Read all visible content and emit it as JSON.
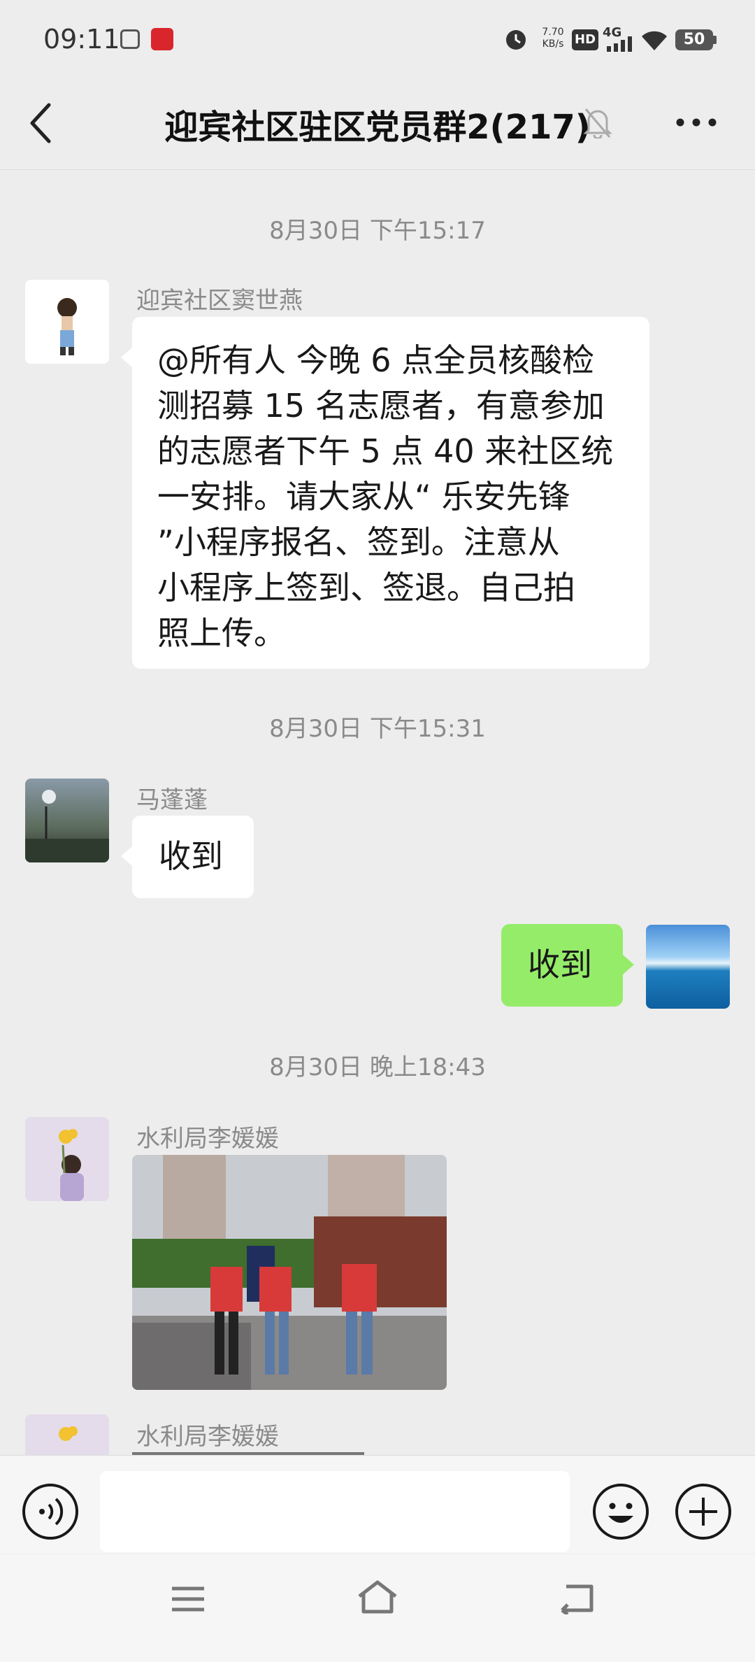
{
  "status_bar": {
    "time": "09:11",
    "net_speed_value": "7.70",
    "net_speed_unit": "KB/s",
    "hd_label": "HD",
    "network_label": "4G",
    "battery_level": "50"
  },
  "nav": {
    "title": "迎宾社区驻区党员群2(217)"
  },
  "messages": [
    {
      "timestamp": "8月30日 下午15:17",
      "sender": "迎宾社区窦世燕",
      "lines": [
        "@所有人 今晚 6 点全员核酸检",
        "测招募 15 名志愿者，有意参加",
        "的志愿者下午 5 点 40 来社区统",
        "一安排。请大家从“ 乐安先锋",
        "”小程序报名、签到。注意从",
        "小程序上签到、签退。自己拍",
        "照上传。"
      ]
    },
    {
      "timestamp": "8月30日 下午15:31",
      "sender": "马蓬蓬",
      "text": "收到"
    },
    {
      "sender": "me",
      "text": "收到"
    },
    {
      "timestamp": "8月30日 晚上18:43",
      "sender": "水利局李媛媛"
    },
    {
      "sender": "水利局李媛媛"
    }
  ],
  "colors": {
    "my_bubble": "#95ec69",
    "background": "#ededed"
  },
  "icons": {
    "back": "chevron-left-icon",
    "mute": "bell-off-icon",
    "more": "more-icon",
    "voice": "voice-icon",
    "emoji": "emoji-icon",
    "plus": "plus-icon",
    "menu": "menu-icon",
    "home": "home-icon",
    "return": "back-arrow-icon"
  }
}
